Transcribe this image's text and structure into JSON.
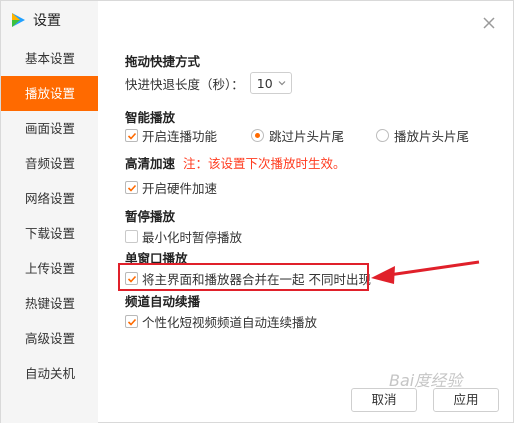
{
  "window": {
    "title": "设置"
  },
  "sidebar": {
    "items": [
      {
        "label": "基本设置",
        "active": false
      },
      {
        "label": "播放设置",
        "active": true
      },
      {
        "label": "画面设置",
        "active": false
      },
      {
        "label": "音频设置",
        "active": false
      },
      {
        "label": "网络设置",
        "active": false
      },
      {
        "label": "下载设置",
        "active": false
      },
      {
        "label": "上传设置",
        "active": false
      },
      {
        "label": "热键设置",
        "active": false
      },
      {
        "label": "高级设置",
        "active": false
      },
      {
        "label": "自动关机",
        "active": false
      }
    ]
  },
  "sections": {
    "drag": {
      "title": "拖动快捷方式",
      "seek_label": "快进快退长度（秒）：",
      "seek_value": "10"
    },
    "smart": {
      "title": "智能播放",
      "continuous": "开启连播功能",
      "skip_intro": "跳过片头片尾",
      "play_intro": "播放片头片尾"
    },
    "hd": {
      "title": "高清加速",
      "note": "注：该设置下次播放时生效。",
      "hardware": "开启硬件加速"
    },
    "pause": {
      "title": "暂停播放",
      "minimize": "最小化时暂停播放"
    },
    "single": {
      "title": "单窗口播放",
      "merge": "将主界面和播放器合并在一起 不同时出现"
    },
    "channel": {
      "title": "频道自动续播",
      "shortvideo": "个性化短视频频道自动连续播放"
    }
  },
  "buttons": {
    "cancel": "取消",
    "apply": "应用"
  },
  "watermark": "Bai度经验",
  "colors": {
    "accent": "#ff6a00",
    "highlight": "#e0202a",
    "note": "#ff3b1f"
  }
}
